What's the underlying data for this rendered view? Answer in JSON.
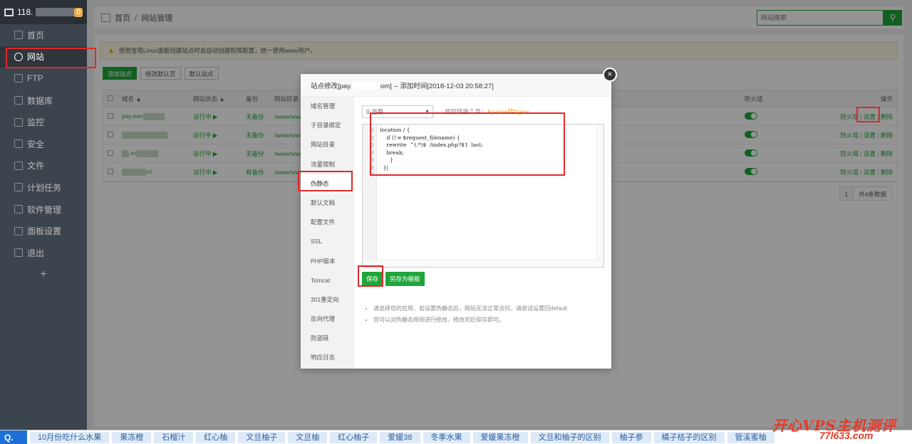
{
  "sidebar": {
    "server": "118.",
    "badge": "0",
    "items": [
      "首页",
      "网站",
      "FTP",
      "数据库",
      "监控",
      "安全",
      "文件",
      "计划任务",
      "软件管理",
      "面板设置",
      "退出"
    ],
    "add": "+"
  },
  "header": {
    "home": "首页",
    "sep": "/",
    "current": "网站管理",
    "search_placeholder": "网站搜索"
  },
  "notice": "使用宝塔Linux面板创建站点时会自动创建权限配置，统一使用www用户。",
  "toolbar": [
    "添加站点",
    "修改默认页",
    "默认站点"
  ],
  "table": {
    "headers": [
      "域名 ▲",
      "网站状态 ▲",
      "备份",
      "网站目录",
      "防火墙",
      "操作"
    ],
    "rows": [
      {
        "name": "pay.eon",
        "status": "运行中 ▶",
        "backup": "无备份",
        "dir": "/www/www"
      },
      {
        "name": "",
        "status": "运行中 ▶",
        "backup": "无备份",
        "dir": "/www/www"
      },
      {
        "name": ".ec",
        "status": "运行中 ▶",
        "backup": "无备份",
        "dir": "/www/www"
      },
      {
        "name": "cc",
        "status": "运行中 ▶",
        "backup": "有备份",
        "dir": "/www/www"
      }
    ],
    "ops": {
      "fw": "防火墙",
      "sep": "|",
      "settings": "设置",
      "delete": "删除"
    },
    "pager": {
      "page": "1",
      "total": "共4条数据"
    }
  },
  "modal": {
    "title_prefix": "站点修改[pay.",
    "title_suffix": "om] -- 添加时间[2018-12-03 20:58:27]",
    "close": "×",
    "tabs": [
      "域名管理",
      "子目录绑定",
      "网站目录",
      "流量限制",
      "伪静态",
      "默认文档",
      "配置文件",
      "SSL",
      "PHP版本",
      "Tomcat",
      "301重定向",
      "反向代理",
      "防盗链",
      "响应日志"
    ],
    "select_value": "0.当前",
    "rule_tool_prefix": "规则转换工具：",
    "rule_tool_link": "Apache转Nginx",
    "line_numbers": [
      "1",
      "2",
      "3",
      "4",
      "5",
      "6",
      "7"
    ],
    "code": "location / {\n    if (!-e $request_filename) {\n    rewrite  ^(.*)$  /index.php?$1  last;\n    break;\n      }\n  }|",
    "save": "保存",
    "save_template": "另存为模板",
    "tips": [
      "请选择您的应用，若设置伪静态后，网站无法正常访问，请尝试设置回default",
      "您可以对伪静态规则进行修改，修改完后保存即可。"
    ]
  },
  "bottom": {
    "keywords": [
      "10月份吃什么水果",
      "果冻橙",
      "石榴汁",
      "红心柚",
      "文旦柚子",
      "文旦柚",
      "红心柚子",
      "爱媛38",
      "冬季水果",
      "爱媛果冻橙",
      "文旦和柚子的区别",
      "柚子参",
      "橘子桔子的区别",
      "管溪蜜柚"
    ]
  },
  "watermark": {
    "line1": "开心VPS主机测评",
    "line2": "77l633.com"
  }
}
